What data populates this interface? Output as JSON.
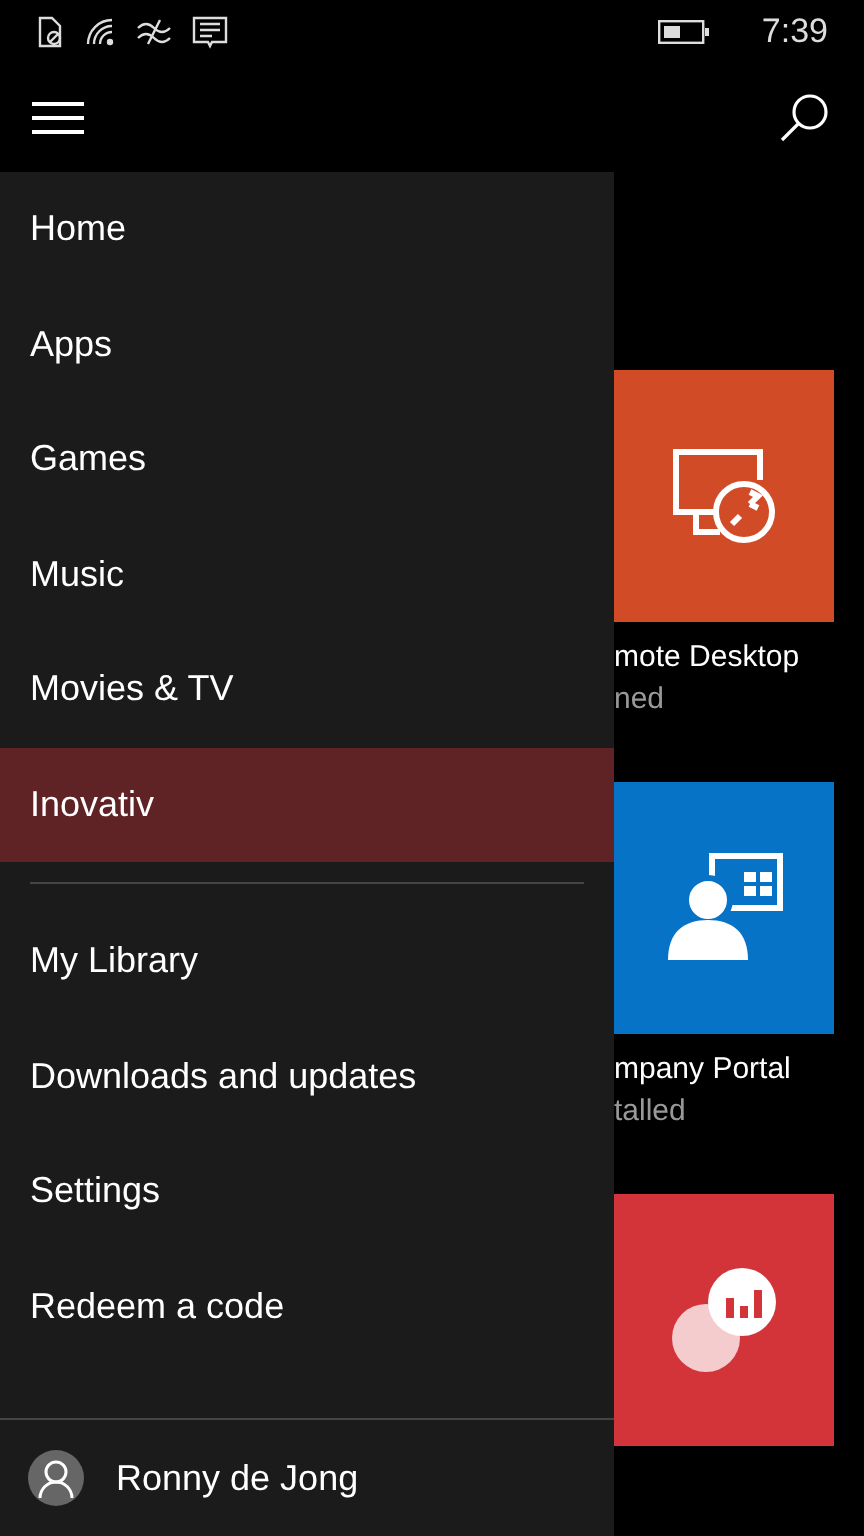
{
  "status_bar": {
    "time": "7:39"
  },
  "menu": {
    "items": [
      {
        "label": "Home",
        "selected": false
      },
      {
        "label": "Apps",
        "selected": false
      },
      {
        "label": "Games",
        "selected": false
      },
      {
        "label": "Music",
        "selected": false
      },
      {
        "label": "Movies & TV",
        "selected": false
      },
      {
        "label": "Inovativ",
        "selected": true
      }
    ],
    "secondary_items": [
      {
        "label": "My Library"
      },
      {
        "label": "Downloads and updates"
      },
      {
        "label": "Settings"
      },
      {
        "label": "Redeem a code"
      }
    ],
    "user": {
      "name": "Ronny de Jong"
    }
  },
  "tiles": [
    {
      "kind": "remote",
      "color": "#d14b27",
      "name": "mote Desktop",
      "status": "ned"
    },
    {
      "kind": "portal",
      "color": "#0673c7",
      "name": "mpany Portal",
      "status": "talled"
    },
    {
      "kind": "analytics",
      "color": "#d3343a"
    }
  ]
}
